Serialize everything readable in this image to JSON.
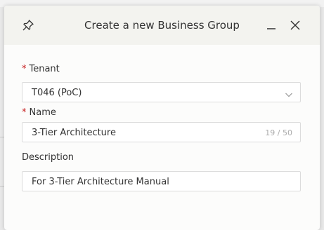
{
  "dialog": {
    "title": "Create a new Business Group",
    "icons": {
      "pin": "pin-icon",
      "minimize": "minimize-icon",
      "close": "close-icon"
    }
  },
  "fields": {
    "tenant": {
      "label": "Tenant",
      "required": "*",
      "value": "T046 (PoC)"
    },
    "name": {
      "label": "Name",
      "required": "*",
      "value": "3-Tier Architecture",
      "counter": "19 / 50"
    },
    "description": {
      "label": "Description",
      "value": "For 3-Tier Architecture Manual"
    }
  },
  "colors": {
    "required": "#c72121",
    "header_bg": "#f3f3ef",
    "border": "#dcdcdc"
  }
}
